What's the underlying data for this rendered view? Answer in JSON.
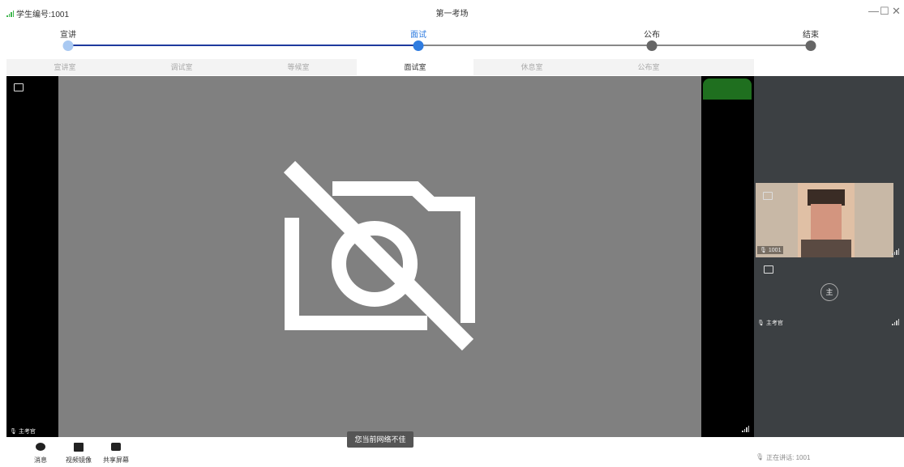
{
  "titlebar": {
    "student_id": "学生编号:1001",
    "title": "第一考场",
    "minimize": "—",
    "maximize": "☐",
    "close": "✕"
  },
  "stages": [
    {
      "label": "宣讲",
      "state": "done",
      "color": "#a9c9f2"
    },
    {
      "label": "面试",
      "state": "current",
      "color": "#2f7ce0"
    },
    {
      "label": "公布",
      "state": "pending",
      "color": "#666666"
    },
    {
      "label": "结束",
      "state": "pending",
      "color": "#666666"
    }
  ],
  "progress_colors": {
    "done": "#1e3a9e",
    "pending": "#888888"
  },
  "tabs": [
    {
      "label": "宣讲室",
      "active": false
    },
    {
      "label": "调试室",
      "active": false
    },
    {
      "label": "等候室",
      "active": false
    },
    {
      "label": "面试室",
      "active": true
    },
    {
      "label": "休息室",
      "active": false
    },
    {
      "label": "公布室",
      "active": false
    }
  ],
  "main_video": {
    "speaker_label": "主考官",
    "camera_state": "camera-off-icon"
  },
  "participants": [
    {
      "name": "1001",
      "has_video": true
    },
    {
      "name": "主考官",
      "avatar_text": "主",
      "has_video": false
    }
  ],
  "toolbar": {
    "message": "消息",
    "mirror": "视频镜像",
    "share": "共享屏幕"
  },
  "toast": "您当前网络不佳",
  "speaking_status": "正在讲话: 1001"
}
